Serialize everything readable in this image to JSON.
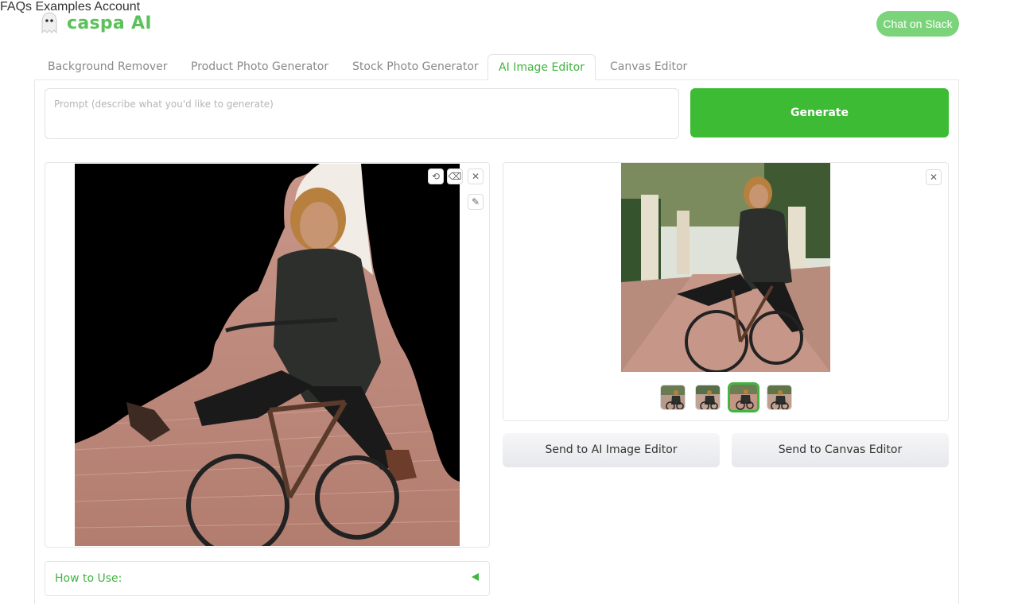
{
  "brand": {
    "name": "caspa AI",
    "icon": "ghost-icon",
    "color": "#5cc15a"
  },
  "nav": {
    "faqs": "FAQs",
    "examples": "Examples",
    "account": "Account",
    "slack": "Chat on Slack"
  },
  "tabs": [
    {
      "label": "Background Remover"
    },
    {
      "label": "Product Photo Generator"
    },
    {
      "label": "Stock Photo Generator"
    },
    {
      "label": "AI Image Editor",
      "active": true
    },
    {
      "label": "Canvas Editor"
    }
  ],
  "prompt": {
    "placeholder": "Prompt (describe what you'd like to generate)"
  },
  "generate": {
    "label": "Generate",
    "color": "#3dbb35"
  },
  "editor": {
    "tools": {
      "undo": "undo-icon",
      "erase": "eraser-icon",
      "close": "close-icon",
      "brush": "brush-icon"
    }
  },
  "result": {
    "close": "close-icon",
    "thumbnails": 4,
    "selected_thumbnail": 3
  },
  "actions": {
    "send_ai": "Send to AI Image Editor",
    "send_canvas": "Send to Canvas Editor"
  },
  "howto": {
    "label": "How to Use:",
    "icon": "triangle-left-icon"
  }
}
